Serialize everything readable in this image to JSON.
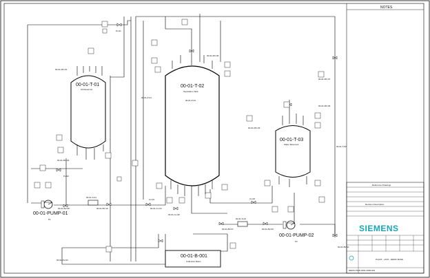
{
  "notes_label": "NOTES",
  "tanks": {
    "t01": {
      "tag": "00-01-T-01",
      "name": "Oil Reservoir"
    },
    "t02": {
      "tag": "00-01-T-02",
      "name": "Separation Tank",
      "sub": "00-01-P-02"
    },
    "t03": {
      "tag": "00-01-T-03",
      "name": "Water Reservoir"
    }
  },
  "pumps": {
    "p01": {
      "tag": "00-01-PUMP-01",
      "sub": "P1"
    },
    "p02": {
      "tag": "00-01-PUMP-02",
      "sub": "P2"
    }
  },
  "basin": {
    "tag": "00-01-B-001",
    "name": "Collection Basin"
  },
  "instruments": [
    "00-01-MV-01",
    "Pv-01",
    "00-01-MV-02",
    "Pv-02",
    "00-01-P-01",
    "00-01-S-01",
    "00-01-BV-08",
    "00-01-BV-10",
    "Cv-03",
    "00-01-Cv-04",
    "00-01-Cv-08",
    "00-01-S-02",
    "00-01-BV-07",
    "00-01-BV-09",
    "00-01-FV-03",
    "00-01-MV-03",
    "00-01-MV-05",
    "00-01-MV-06",
    "00-01-T-02",
    "Cv-06",
    "00-01-MV-07",
    "00-01-PT-01",
    "00-01-LT-01",
    "00-01-BV-11"
  ],
  "title_block": {
    "row1": "Reference Drawings",
    "row2": "",
    "row3": "Revision Description",
    "brand": "SIEMENS",
    "plant_line": "PLANT - UNIT - DEMO BASE",
    "dwg_no": "DEMO-P&ID-0001-0000-001"
  },
  "colors": {
    "brand": "#1aa6b7",
    "lines": "#000000"
  }
}
